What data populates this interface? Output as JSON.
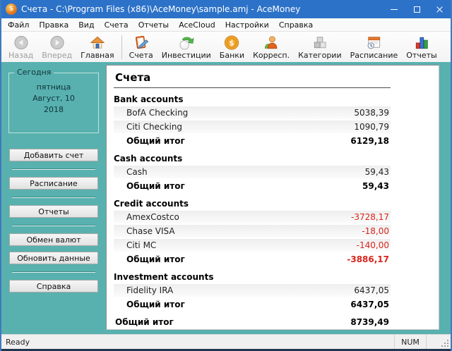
{
  "window": {
    "title": "Счета - C:\\Program Files (x86)\\AceMoney\\sample.amj - AceMoney",
    "icon_letter": "S",
    "controls": [
      "minimize",
      "maximize",
      "close"
    ]
  },
  "menu": {
    "items": [
      {
        "id": "file",
        "label": "Файл"
      },
      {
        "id": "edit",
        "label": "Правка"
      },
      {
        "id": "view",
        "label": "Вид"
      },
      {
        "id": "accounts",
        "label": "Счета"
      },
      {
        "id": "reports",
        "label": "Отчеты"
      },
      {
        "id": "acecloud",
        "label": "AceCloud"
      },
      {
        "id": "settings",
        "label": "Настройки"
      },
      {
        "id": "help",
        "label": "Справка"
      }
    ]
  },
  "toolbar": {
    "items": [
      {
        "id": "back",
        "label": "Назад",
        "icon": "back-arrow-icon",
        "disabled": true
      },
      {
        "id": "forward",
        "label": "Вперед",
        "icon": "forward-arrow-icon",
        "disabled": true
      },
      {
        "id": "home",
        "label": "Главная",
        "icon": "home-icon",
        "separator_after": true
      },
      {
        "id": "accounts",
        "label": "Счета",
        "icon": "ledger-book-icon"
      },
      {
        "id": "investments",
        "label": "Инвестиции",
        "icon": "investment-sphere-icon"
      },
      {
        "id": "banks",
        "label": "Банки",
        "icon": "gold-coin-icon"
      },
      {
        "id": "payees",
        "label": "Корресп.",
        "icon": "payee-person-icon"
      },
      {
        "id": "categories",
        "label": "Категории",
        "icon": "categories-boxes-icon"
      },
      {
        "id": "schedule",
        "label": "Расписание",
        "icon": "schedule-calendar-icon"
      },
      {
        "id": "reports",
        "label": "Отчеты",
        "icon": "report-chart-icon"
      }
    ]
  },
  "sidebar": {
    "today": {
      "legend": "Сегодня",
      "weekday": "пятница",
      "monthday": "Август, 10",
      "year": "2018"
    },
    "button_groups": [
      [
        {
          "id": "add-account",
          "label": "Добавить счет"
        }
      ],
      [
        {
          "id": "schedule",
          "label": "Расписание"
        }
      ],
      [
        {
          "id": "reports",
          "label": "Отчеты"
        }
      ],
      [
        {
          "id": "currency-exchange",
          "label": "Обмен валют"
        },
        {
          "id": "update-data",
          "label": "Обновить данные"
        }
      ],
      [
        {
          "id": "help",
          "label": "Справка"
        }
      ]
    ]
  },
  "main": {
    "title": "Счета",
    "total_label": "Общий итог",
    "groups": [
      {
        "id": "bank",
        "name": "Bank accounts",
        "rows": [
          {
            "label": "BofA Checking",
            "amount": "5038,39",
            "negative": false
          },
          {
            "label": "Citi Checking",
            "amount": "1090,79",
            "negative": false
          }
        ],
        "total": "6129,18",
        "total_negative": false
      },
      {
        "id": "cash",
        "name": "Cash accounts",
        "rows": [
          {
            "label": "Cash",
            "amount": "59,43",
            "negative": false
          }
        ],
        "total": "59,43",
        "total_negative": false
      },
      {
        "id": "credit",
        "name": "Credit accounts",
        "rows": [
          {
            "label": "AmexCostco",
            "amount": "-3728,17",
            "negative": true
          },
          {
            "label": "Chase VISA",
            "amount": "-18,00",
            "negative": true
          },
          {
            "label": "Citi MC",
            "amount": "-140,00",
            "negative": true
          }
        ],
        "total": "-3886,17",
        "total_negative": true
      },
      {
        "id": "investment",
        "name": "Investment accounts",
        "rows": [
          {
            "label": "Fidelity IRA",
            "amount": "6437,05",
            "negative": false
          }
        ],
        "total": "6437,05",
        "total_negative": false
      }
    ],
    "grand_total": "8739,49"
  },
  "statusbar": {
    "status": "Ready",
    "num": "NUM"
  },
  "colors": {
    "titlebar": "#2c72c8",
    "sidebar_background": "#58b1ae",
    "negative_amount": "#d8251c",
    "window_border": "#3f79c0"
  }
}
